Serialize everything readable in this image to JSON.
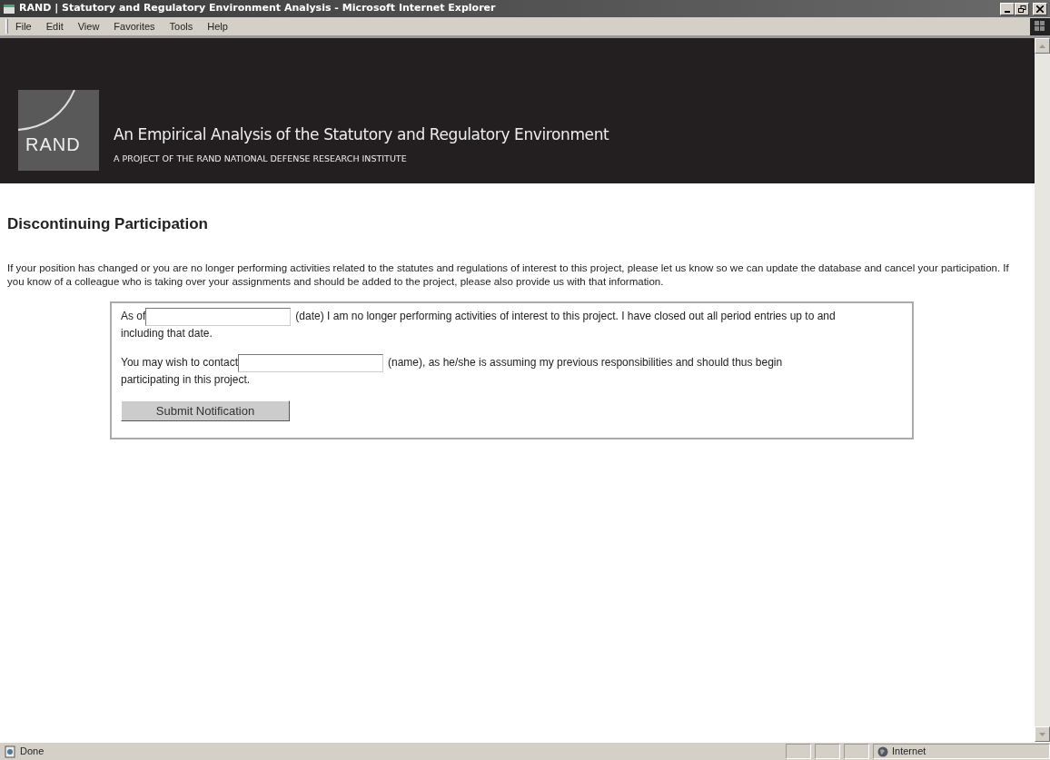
{
  "window": {
    "title": "RAND | Statutory and Regulatory Environment Analysis - Microsoft Internet Explorer"
  },
  "menu": [
    "File",
    "Edit",
    "View",
    "Favorites",
    "Tools",
    "Help"
  ],
  "header": {
    "logo_text": "RAND",
    "title": "An Empirical Analysis of the Statutory and Regulatory Environment",
    "subtitle": "A PROJECT OF THE RAND NATIONAL DEFENSE RESEARCH INSTITUTE"
  },
  "page": {
    "heading": "Discontinuing Participation",
    "intro": "If your position has changed or you are no longer performing activities related to the statutes and regulations of interest to this project, please let us know so we can update the database and cancel your participation. If you know of a colleague who is taking over your assignments and should be added to the project, please also provide us with that information."
  },
  "form": {
    "fields": [
      {
        "before": "As of",
        "after": "(date) I am no longer performing activities of interest to this project. I have closed out all period entries up to and",
        "continuation": "including that date."
      },
      {
        "before": "You may wish to contact",
        "after": "(name), as he/she is assuming my previous responsibilities and should thus begin",
        "continuation": "participating in this project."
      }
    ],
    "submit": "Submit Notification"
  },
  "status_bar": {
    "text": "Done",
    "zone": "Internet"
  }
}
